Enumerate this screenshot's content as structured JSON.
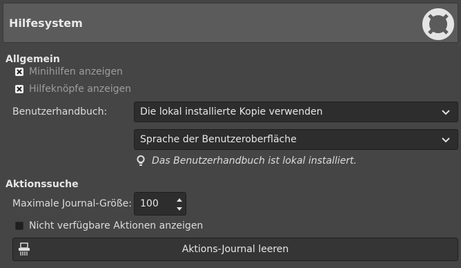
{
  "header": {
    "title": "Hilfesystem",
    "logo_icon": "life-ring-icon"
  },
  "general": {
    "title": "Allgemein",
    "show_tooltips": {
      "label": "Minihilfen anzeigen",
      "checked": true
    },
    "show_help_buttons": {
      "label": "Hilfeknöpfe anzeigen",
      "checked": true
    },
    "manual_label": "Benutzerhandbuch:",
    "manual_select": "Die lokal installierte Kopie verwenden",
    "language_select": "Sprache der Benutzeroberfläche",
    "hint_icon": "lightbulb-icon",
    "hint_text": "Das Benutzerhandbuch ist lokal installiert."
  },
  "action_search": {
    "title": "Aktionssuche",
    "journal_label": "Maximale Journal-Größe:",
    "journal_value": "100",
    "show_unavailable": {
      "label": "Nicht verfügbare Aktionen anzeigen",
      "checked": false
    },
    "clear_button": "Aktions-Journal leeren",
    "clear_icon": "shredder-icon"
  },
  "colors": {
    "background": "#454545",
    "header": "#5b5b5b",
    "field": "#2d2d2d"
  }
}
